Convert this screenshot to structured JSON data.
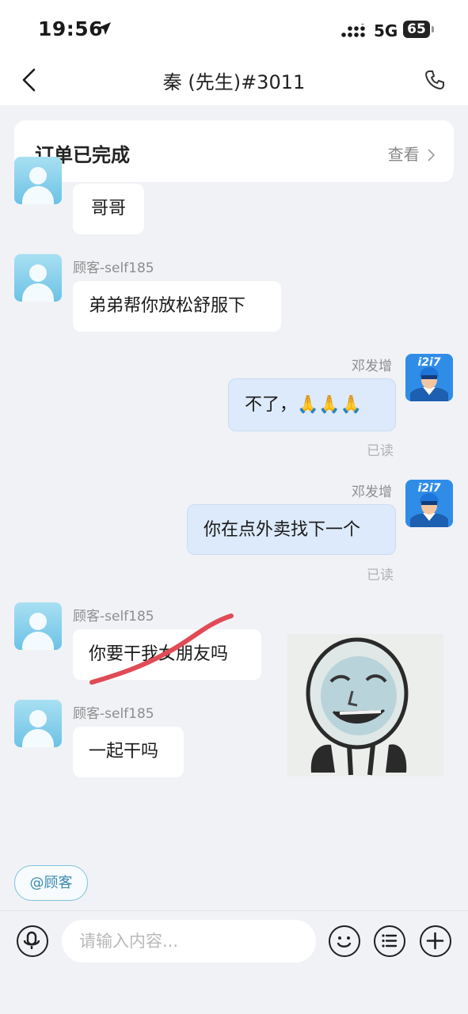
{
  "status_bar": {
    "time": "19:56",
    "network": "5G",
    "battery": "65"
  },
  "nav": {
    "title": "秦 (先生)#3011"
  },
  "order_card": {
    "status": "订单已完成",
    "view_label": "查看"
  },
  "messages": [
    {
      "side": "left",
      "text": "哥哥"
    },
    {
      "side": "left",
      "sender": "顾客-self185",
      "text": "弟弟帮你放松舒服下"
    },
    {
      "side": "right",
      "sender": "邓发增",
      "text": "不了，🙏🙏🙏",
      "status": "已读"
    },
    {
      "side": "right",
      "sender": "邓发增",
      "text": "你在点外卖找下一个",
      "status": "已读"
    },
    {
      "side": "left",
      "sender": "顾客-self185",
      "text": "你要干我女朋友吗"
    },
    {
      "side": "left",
      "sender": "顾客-self185",
      "text": "一起干吗"
    }
  ],
  "rider_avatar_logo": "i2i7",
  "mention_chip": "@顾客",
  "input": {
    "placeholder": "请输入内容..."
  },
  "icons": [
    "location-arrow-icon",
    "signal-icon",
    "back-icon",
    "phone-icon",
    "chevron-right-icon",
    "voice-icon",
    "emoji-icon",
    "menu-list-icon",
    "add-icon"
  ]
}
